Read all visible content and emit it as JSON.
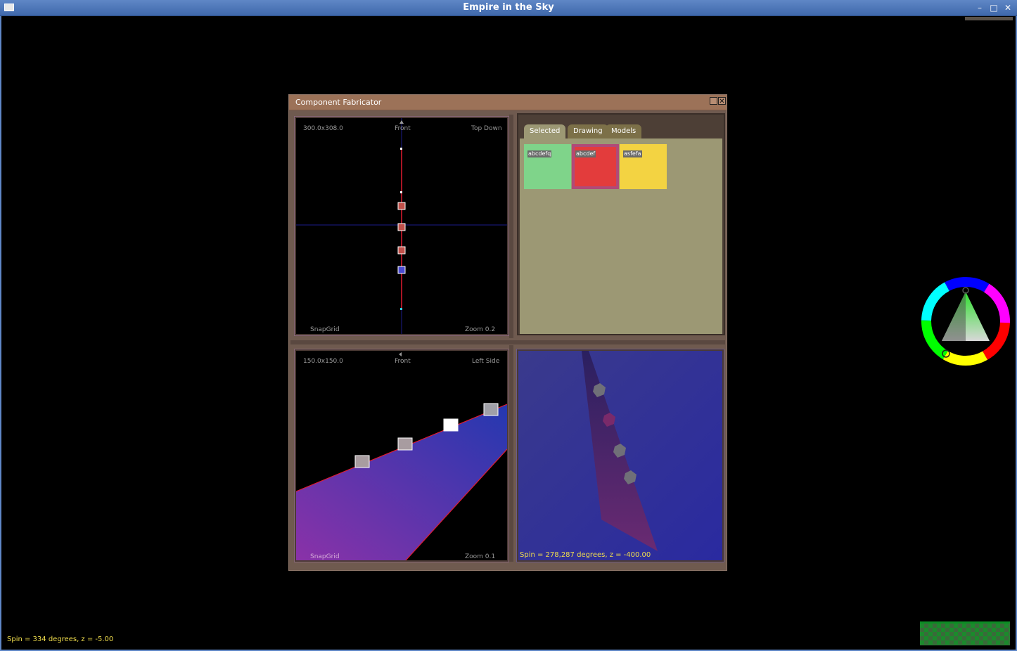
{
  "os_window": {
    "title": "Empire in the Sky"
  },
  "fabricator": {
    "title": "Component Fabricator",
    "top_down_view": {
      "dimensions": "300.0x308.0",
      "orientation": "Front",
      "view_name": "Top Down",
      "snap": "SnapGrid",
      "zoom": "Zoom 0.2"
    },
    "left_side_view": {
      "dimensions": "150.0x150.0",
      "orientation": "Front",
      "view_name": "Left Side",
      "snap": "SnapGrid",
      "zoom": "Zoom 0.1"
    },
    "tabs": [
      {
        "label": "Selected"
      },
      {
        "label": "Drawing"
      },
      {
        "label": "Models"
      }
    ],
    "swatches": [
      {
        "label": "abcdefq",
        "color": "#7fd48a"
      },
      {
        "label": "abcdef",
        "color": "#e33c3c"
      },
      {
        "label": "asfefa",
        "color": "#f3d342"
      }
    ],
    "preview_3d": {
      "status": "Spin = 278,287 degrees, z = -400.00"
    }
  },
  "status_bar": {
    "spin": "Spin = 334 degrees, z = -5.00"
  },
  "icons": {
    "color_wheel": "color-wheel-picker",
    "progress": "checkerboard-indicator"
  }
}
